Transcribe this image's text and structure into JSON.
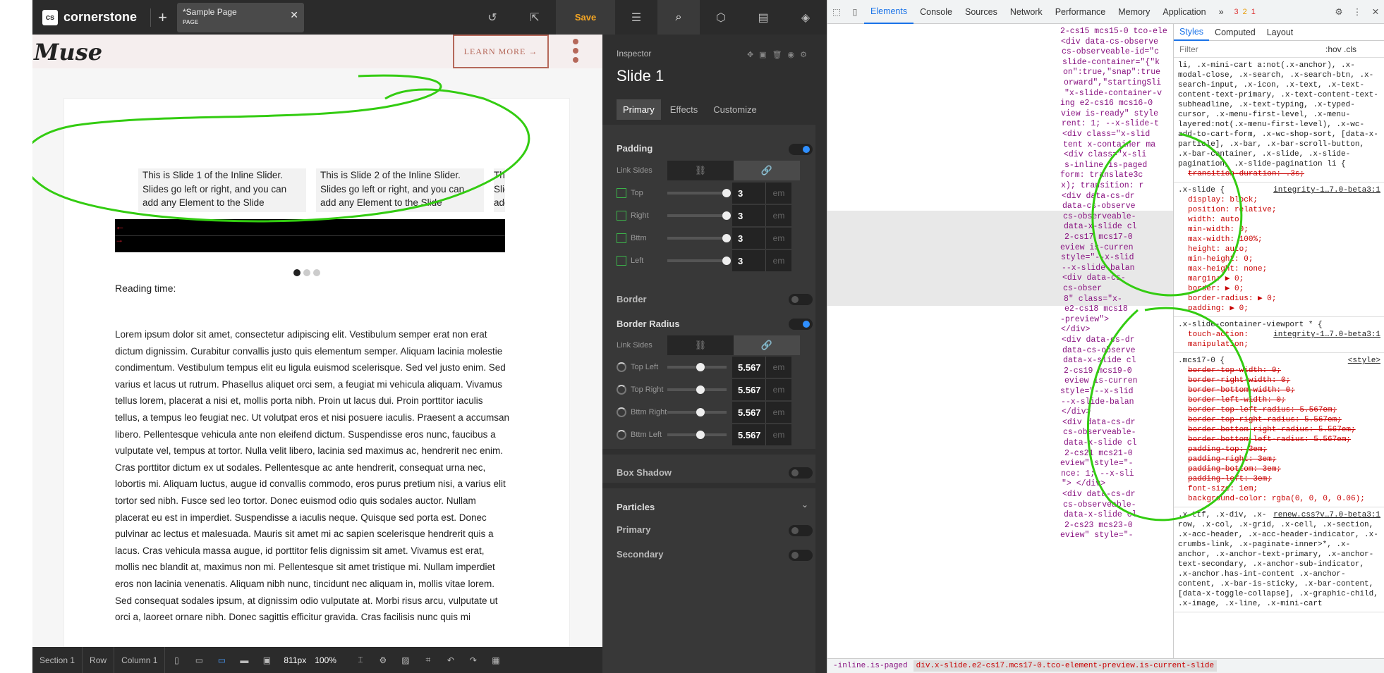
{
  "topbar": {
    "logo_badge": "cs",
    "logo_text": "cornerstone",
    "tab_title": "*Sample Page",
    "tab_subtitle": "PAGE",
    "save_label": "Save"
  },
  "preview": {
    "brand": "Muse",
    "learn_more": "LEARN MORE →",
    "slides": [
      "This is Slide 1 of the Inline Slider. Slides go left or right, and you can add any Element to the Slide Container. Navigation and pagination",
      "This is Slide 2 of the Inline Slider. Slides go left or right, and you can add any Element to the Slide Container. Navigation and pagination",
      "Thi Slic add Co"
    ],
    "reading_time": "Reading time:",
    "lorem": "Lorem ipsum dolor sit amet, consectetur adipiscing elit. Vestibulum semper erat non erat dictum dignissim. Curabitur convallis justo quis elementum semper. Aliquam lacinia molestie condimentum. Vestibulum tempus elit eu ligula euismod scelerisque. Sed vel justo enim. Sed varius et lacus ut rutrum. Phasellus aliquet orci sem, a feugiat mi vehicula aliquam. Vivamus tellus lorem, placerat a nisi et, mollis porta nibh. Proin ut lacus dui. Proin porttitor iaculis tellus, a tempus leo feugiat nec. Ut volutpat eros et nisi posuere iaculis. Praesent a accumsan libero. Pellentesque vehicula ante non eleifend dictum. Suspendisse eros nunc, faucibus a vulputate vel, tempus at tortor. Nulla velit libero, lacinia sed maximus ac, hendrerit nec enim. Cras porttitor dictum ex ut sodales. Pellentesque ac ante hendrerit, consequat urna nec, lobortis mi. Aliquam luctus, augue id convallis commodo, eros purus pretium nisi, a varius elit tortor sed nibh. Fusce sed leo tortor. Donec euismod odio quis sodales auctor. Nullam placerat eu est in imperdiet. Suspendisse a iaculis neque. Quisque sed porta est. Donec pulvinar ac lectus et malesuada. Mauris sit amet mi ac sapien scelerisque hendrerit quis a lacus. Cras vehicula massa augue, id porttitor felis dignissim sit amet. Vivamus est erat, mollis nec blandit at, maximus non mi. Pellentesque sit amet tristique mi. Nullam imperdiet eros non lacinia venenatis. Aliquam nibh nunc, tincidunt nec aliquam in, mollis vitae lorem. Sed consequat sodales ipsum, at dignissim odio vulputate at. Morbi risus arcu, vulputate ut orci a, laoreet ornare nibh. Donec sagittis efficitur gravida. Cras facilisis nunc quis mi"
  },
  "bottombar": {
    "crumbs": [
      "Section 1",
      "Row",
      "Column 1"
    ],
    "width_value": "811px",
    "zoom": "100%"
  },
  "inspector": {
    "label": "Inspector",
    "title": "Slide 1",
    "tabs": [
      "Primary",
      "Effects",
      "Customize"
    ],
    "padding": {
      "heading": "Padding",
      "link_sides": "Link Sides",
      "rows": [
        {
          "label": "Top",
          "value": "3",
          "unit": "em",
          "level": 1.0
        },
        {
          "label": "Right",
          "value": "3",
          "unit": "em",
          "level": 1.0
        },
        {
          "label": "Bttm",
          "value": "3",
          "unit": "em",
          "level": 1.0
        },
        {
          "label": "Left",
          "value": "3",
          "unit": "em",
          "level": 1.0
        }
      ]
    },
    "border": "Border",
    "border_radius": {
      "heading": "Border Radius",
      "link_sides": "Link Sides",
      "rows": [
        {
          "label": "Top Left",
          "value": "5.567",
          "unit": "em",
          "level": 0.56
        },
        {
          "label": "Top Right",
          "value": "5.567",
          "unit": "em",
          "level": 0.56
        },
        {
          "label": "Bttm Right",
          "value": "5.567",
          "unit": "em",
          "level": 0.56
        },
        {
          "label": "Bttm Left",
          "value": "5.567",
          "unit": "em",
          "level": 0.56
        }
      ]
    },
    "box_shadow": "Box Shadow",
    "particles": "Particles",
    "primary": "Primary",
    "secondary": "Secondary"
  },
  "devtools": {
    "tabs": [
      "Elements",
      "Console",
      "Sources",
      "Network",
      "Performance",
      "Memory",
      "Application"
    ],
    "badges": [
      "3",
      "2",
      "1"
    ],
    "dom_lines": [
      "2-cs15 mcs15-0 tco-ele",
      "<div data-cs-observe",
      "cs-observeable-id=\"c",
      "slide-container=\"{\"k",
      "on\":true,\"snap\":true",
      "orward\",\"startingSli",
      "\"x-slide-container-v",
      "ing e2-cs16 mcs16-0",
      "view is-ready\" style",
      "rent: 1; --x-slide-t",
      "<div class=\"x-slid",
      "tent x-container ma",
      "<div class=\"x-sli",
      "s-inline is-paged",
      "form: translate3c",
      "x); transition: r",
      "<div data-cs-dr",
      "data-cs-observe",
      "cs-observeable-",
      "data-x-slide cl",
      "2-cs17 mcs17-0",
      "eview is-curren",
      "style=\"--x-slid",
      "--x-slide-balan",
      "<div data-cs-",
      "cs-obser",
      "8\" class=\"x-",
      "e2-cs18 mcs18",
      "-preview\">",
      "</div>",
      "<div data-cs-dr",
      "data-cs-observe",
      "data-x-slide cl",
      "2-cs19 mcs19-0",
      "eview is-curren",
      "style=\"--x-slid",
      "--x-slide-balan",
      "</div>",
      "<div data-cs-dr",
      "cs-observeable-",
      "data-x-slide cl",
      "2-cs21 mcs21-0",
      "eview\" style=\"-",
      "nce: 1; --x-sli",
      "\"> </div>",
      "<div data-cs-dr",
      "cs-observeable-",
      "data-x-slide cl",
      "2-cs23 mcs23-0",
      "eview\" style=\"-"
    ],
    "styles_tabs": [
      "Styles",
      "Computed",
      "Layout"
    ],
    "filter_placeholder": "Filter",
    "filter_tools": ":hov .cls",
    "rule_top_selectors": "li, .x-mini-cart a:not(.x-anchor), .x-modal-close, .x-search, .x-search-btn, .x-search-input, .x-icon, .x-text, .x-text-content-text-primary, .x-text-content-text-subheadline, .x-text-typing, .x-typed-cursor, .x-menu-first-level, .x-menu-layered:not(.x-menu-first-level), .x-wc-add-to-cart-form, .x-wc-shop-sort, [data-x-particle], .x-bar, .x-bar-scroll-button, .x-bar-container, .x-slide, .x-slide-pagination, .x-slide-pagination li {",
    "rule_top_prop": "transition-duration: .3s;",
    "xslide": {
      "selector": ".x-slide {",
      "source": "integrity-1…7.0-beta3:1",
      "props": [
        "display: block;",
        "position: relative;",
        "width: auto;",
        "min-width: 0;",
        "max-width: 100%;",
        "height: auto;",
        "min-height: 0;",
        "max-height: none;",
        "margin: ▶ 0;",
        "border: ▶ 0;",
        "border-radius: ▶ 0;",
        "padding: ▶ 0;"
      ]
    },
    "viewport": {
      "selector": ".x-slide-container-viewport * {",
      "source": "integrity-1…7.0-beta3:1",
      "props": [
        "touch-action: manipulation;"
      ]
    },
    "mcs17": {
      "selector": ".mcs17-0 {",
      "source": "<style>",
      "struck": [
        "border-top-width: 0;",
        "border-right-width: 0;",
        "border-bottom-width: 0;",
        "border-left-width: 0;",
        "border-top-left-radius: 5.567em;",
        "border-top-right-radius: 5.567em;",
        "border-bottom-right-radius: 5.567em;",
        "border-bottom-left-radius: 5.567em;",
        "padding-top: 3em;",
        "padding-right: 3em;",
        "padding-bottom: 3em;",
        "padding-left: 3em;"
      ],
      "props": [
        "font-size: 1em;",
        "background-color: rgba(0, 0, 0, 0.06);"
      ]
    },
    "renew": {
      "selector": ".x-ttf, .x-div, .x-row, .x-col, .x-grid, .x-cell, .x-section, .x-acc-header, .x-acc-header-indicator, .x-crumbs-link, .x-paginate-inner>*, .x-anchor, .x-anchor-text-primary, .x-anchor-text-secondary, .x-anchor-sub-indicator, .x-anchor.has-int-content .x-anchor-content, .x-bar-is-sticky, .x-bar-content, [data-x-toggle-collapse], .x-graphic-child, .x-image, .x-line, .x-mini-cart",
      "source": "renew.css?v…7.0-beta3:1"
    },
    "breadcrumb_prev": "-inline.is-paged",
    "breadcrumb_current": "div.x-slide.e2-cs17.mcs17-0.tco-element-preview.is-current-slide"
  },
  "colors": {
    "accent_blue": "#2f8fff",
    "annotation_green": "#33cc11",
    "save_orange": "#f5a623",
    "brand_rose": "#b5685a"
  }
}
